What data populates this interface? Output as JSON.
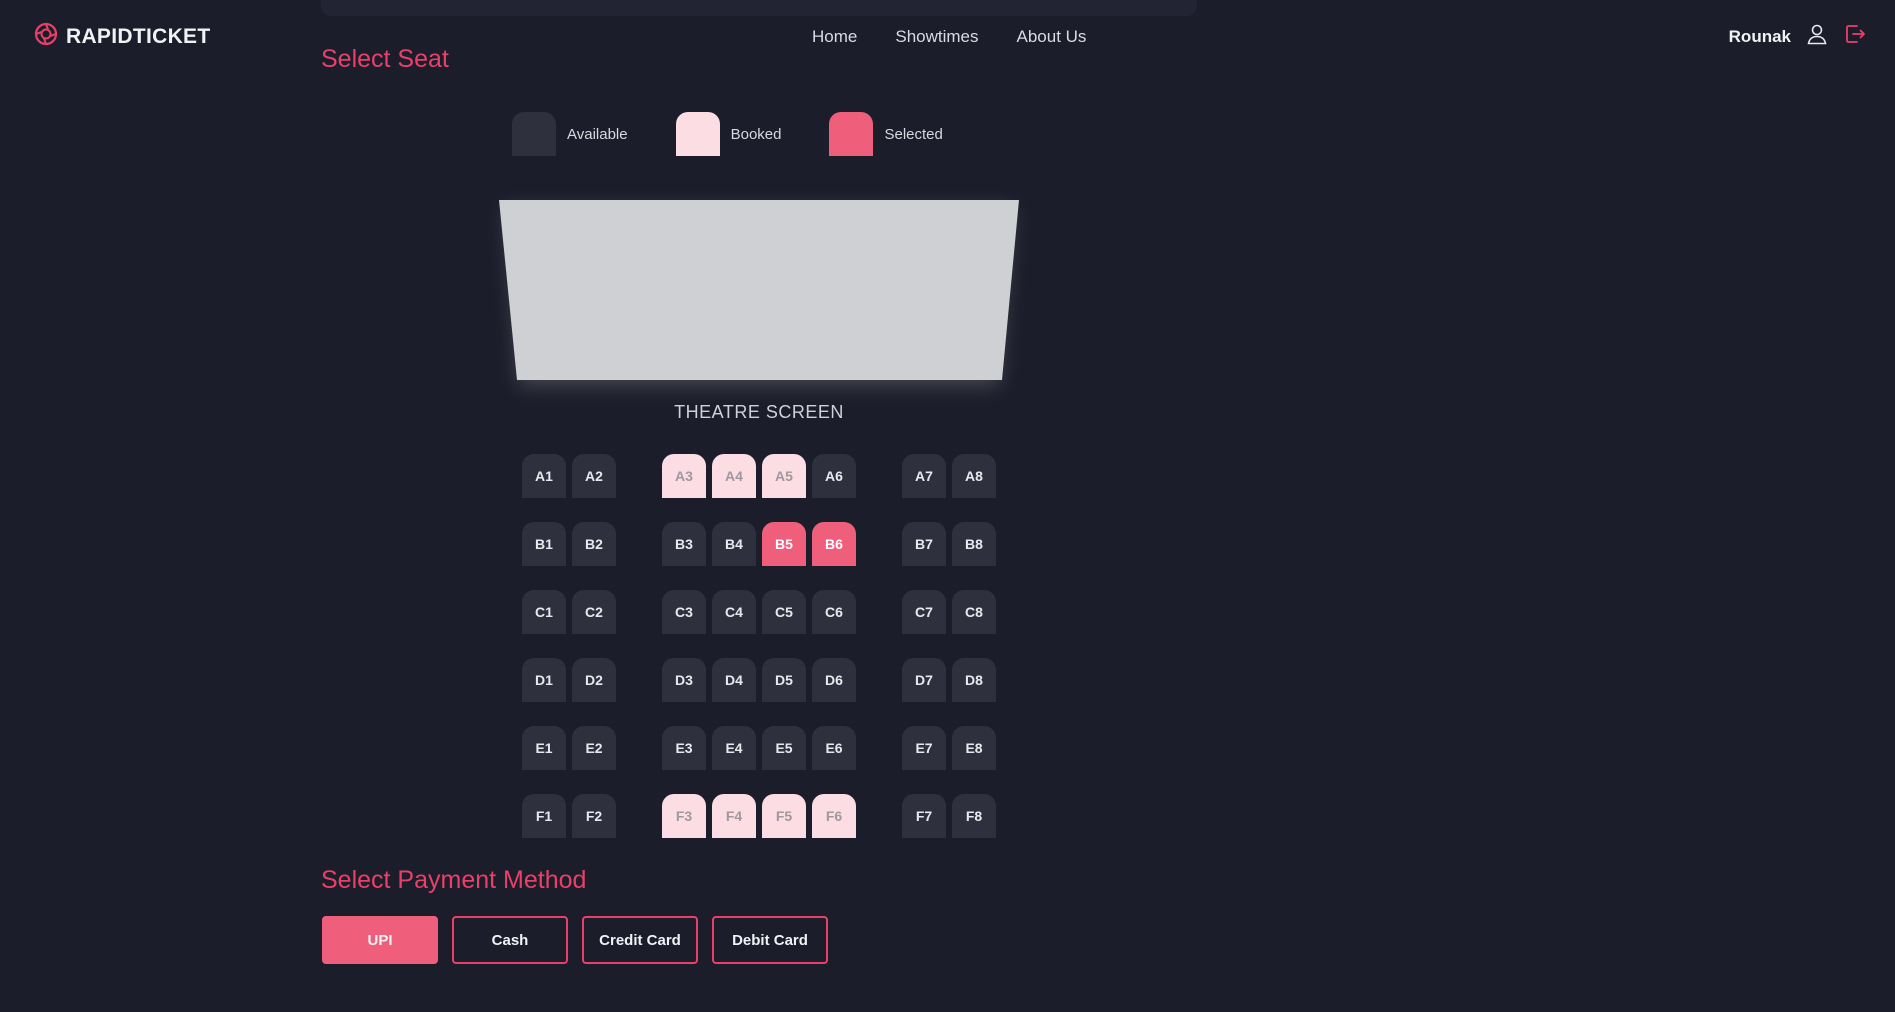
{
  "brand": {
    "name": "RAPIDTICKET"
  },
  "nav": {
    "items": [
      "Home",
      "Showtimes",
      "About Us"
    ]
  },
  "user": {
    "name": "Rounak"
  },
  "seat_section": {
    "title": "Select Seat"
  },
  "legend": {
    "items": [
      {
        "label": "Available",
        "color": "#2e313d"
      },
      {
        "label": "Booked",
        "color": "#fddde4"
      },
      {
        "label": "Selected",
        "color": "#ef5f7c"
      }
    ]
  },
  "screen": {
    "label": "THEATRE SCREEN"
  },
  "seats": {
    "rows": [
      "A",
      "B",
      "C",
      "D",
      "E",
      "F"
    ],
    "columns": [
      1,
      2,
      3,
      4,
      5,
      6,
      7,
      8
    ],
    "booked": [
      "A3",
      "A4",
      "A5",
      "F3",
      "F4",
      "F5",
      "F6"
    ],
    "selected": [
      "B5",
      "B6"
    ]
  },
  "payment": {
    "title": "Select Payment Method",
    "methods": [
      "UPI",
      "Cash",
      "Credit Card",
      "Debit Card"
    ],
    "selected": "UPI"
  },
  "colors": {
    "accent": "#e9406a",
    "background": "#1b1d2a"
  }
}
